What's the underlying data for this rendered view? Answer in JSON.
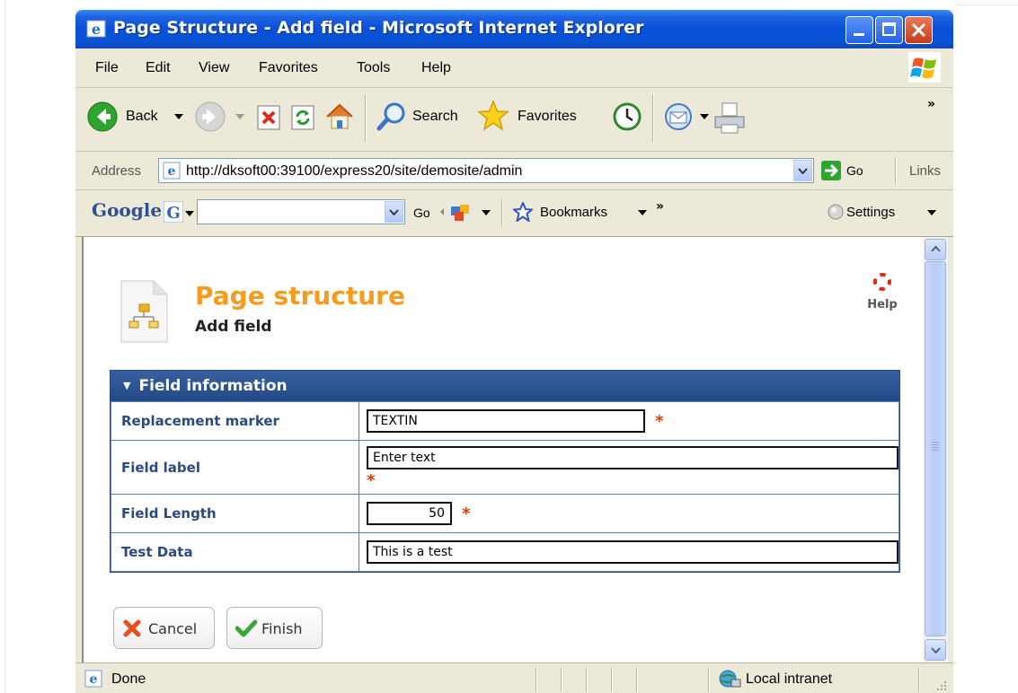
{
  "window": {
    "title": "Page Structure - Add field - Microsoft Internet Explorer"
  },
  "menu": {
    "items": [
      "File",
      "Edit",
      "View",
      "Favorites",
      "Tools",
      "Help"
    ]
  },
  "toolbar": {
    "back_label": "Back",
    "search_label": "Search",
    "favorites_label": "Favorites",
    "more": "»"
  },
  "address": {
    "label": "Address",
    "url": "http://dksoft00:39100/express20/site/demosite/admin",
    "go_label": "Go",
    "links_label": "Links"
  },
  "googlebar": {
    "logo": "Google",
    "go_label": "Go",
    "bookmarks_label": "Bookmarks",
    "more": "»",
    "settings_label": "Settings"
  },
  "page": {
    "title": "Page structure",
    "subtitle": "Add field",
    "help_label": "Help"
  },
  "panel": {
    "title": "Field information",
    "rows": [
      {
        "label": "Replacement marker",
        "value": "TEXTIN",
        "required": true
      },
      {
        "label": "Field label",
        "value": "Enter text",
        "required": true
      },
      {
        "label": "Field Length",
        "value": "50",
        "required": true
      },
      {
        "label": "Test Data",
        "value": "This is a test",
        "required": false
      }
    ],
    "required_mark": "*"
  },
  "buttons": {
    "cancel": "Cancel",
    "finish": "Finish"
  },
  "status": {
    "text": "Done",
    "zone": "Local intranet"
  },
  "colors": {
    "titlebar": "#0a4fd8",
    "page_title": "#f79a1e",
    "panel_header": "#2c4d88",
    "label_text": "#2a4a80",
    "required": "#e23b00"
  }
}
